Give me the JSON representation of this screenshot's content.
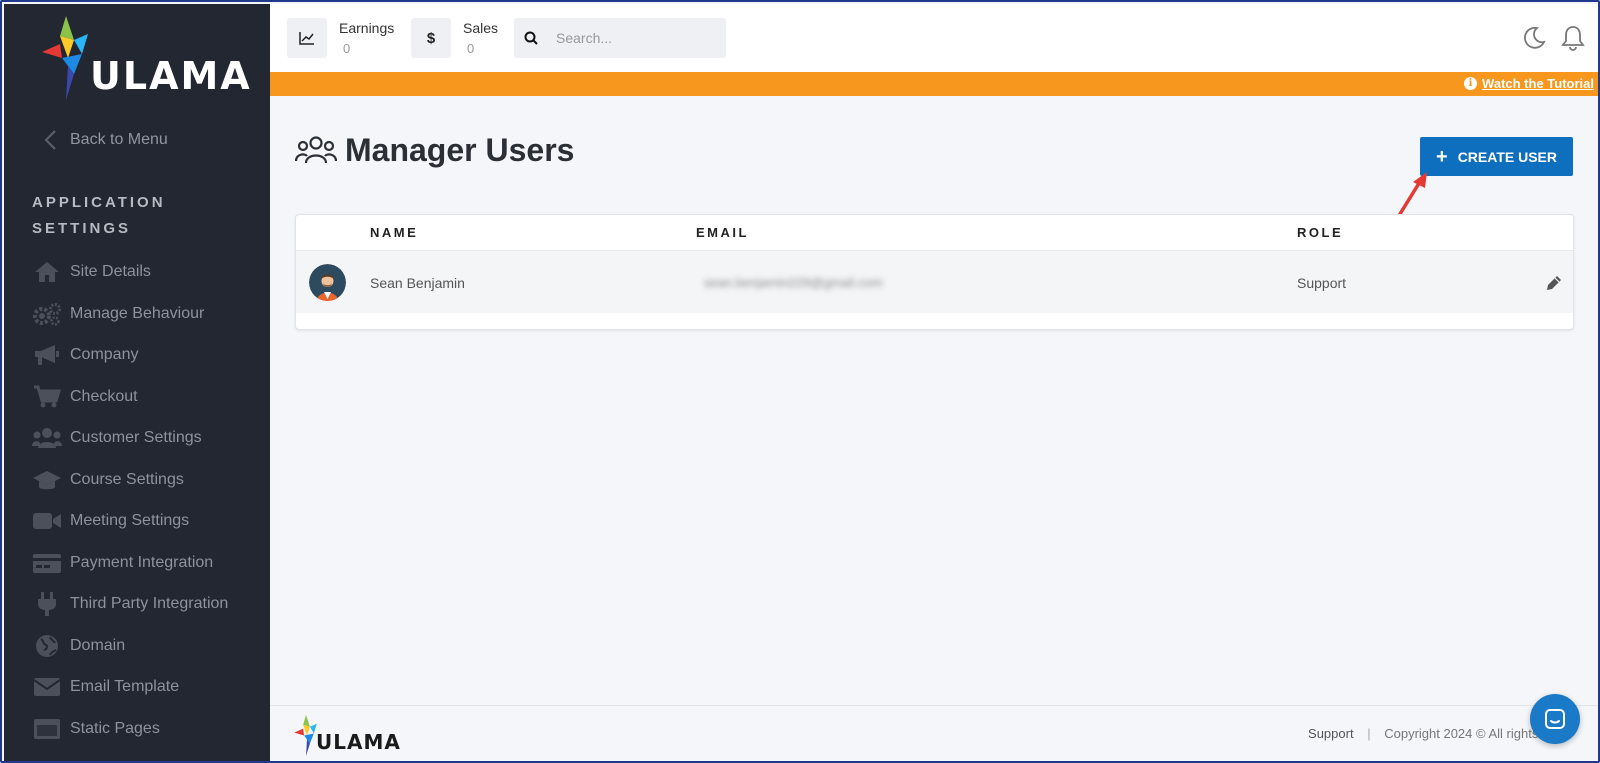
{
  "brand": {
    "name": "ULAMA"
  },
  "sidebar": {
    "back_label": "Back to Menu",
    "section_title": "APPLICATION SETTINGS",
    "items": [
      {
        "label": "Site Details",
        "icon": "home-icon"
      },
      {
        "label": "Manage Behaviour",
        "icon": "gears-icon"
      },
      {
        "label": "Company",
        "icon": "megaphone-icon"
      },
      {
        "label": "Checkout",
        "icon": "cart-icon"
      },
      {
        "label": "Customer Settings",
        "icon": "users-icon"
      },
      {
        "label": "Course Settings",
        "icon": "graduation-cap-icon"
      },
      {
        "label": "Meeting Settings",
        "icon": "video-camera-icon"
      },
      {
        "label": "Payment Integration",
        "icon": "credit-card-icon"
      },
      {
        "label": "Third Party Integration",
        "icon": "plug-icon"
      },
      {
        "label": "Domain",
        "icon": "globe-icon"
      },
      {
        "label": "Email Template",
        "icon": "envelope-icon"
      },
      {
        "label": "Static Pages",
        "icon": "window-icon"
      }
    ]
  },
  "topbar": {
    "earnings": {
      "label": "Earnings",
      "value": "0"
    },
    "sales": {
      "label": "Sales",
      "value": "0"
    },
    "search": {
      "placeholder": "Search..."
    }
  },
  "banner": {
    "link_label": "Watch the Tutorial"
  },
  "main": {
    "title": "Manager Users",
    "create_button": "CREATE USER",
    "table": {
      "columns": [
        "NAME",
        "EMAIL",
        "ROLE"
      ],
      "rows": [
        {
          "name": "Sean Benjamin",
          "email": "sean.benjamin229@gmail.com",
          "role": "Support"
        }
      ]
    }
  },
  "footer": {
    "support": "Support",
    "separator": "|",
    "copyright": "Copyright 2024 © All rights res"
  },
  "colors": {
    "sidebar_bg": "#232731",
    "banner": "#f7971e",
    "primary_button": "#0f6fbf",
    "arrow": "#e53935"
  }
}
